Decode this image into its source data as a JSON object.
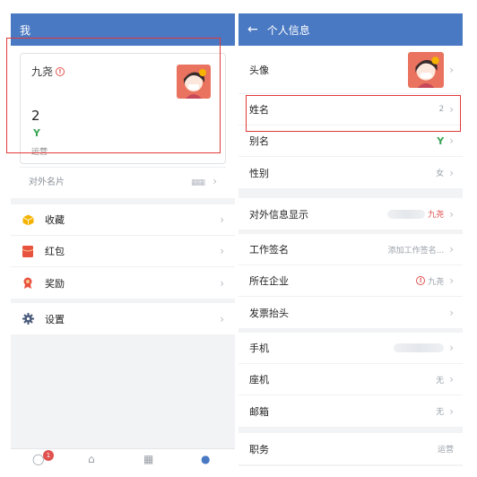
{
  "left": {
    "title": "我",
    "profile": {
      "name": "九尧",
      "number": "2",
      "dept": "运营"
    },
    "namecard_label": "对外名片",
    "menu": [
      {
        "label": "收藏",
        "icon": "box-icon",
        "color": "#f5b300"
      },
      {
        "label": "红包",
        "icon": "red-envelope-icon",
        "color": "#e8533f"
      },
      {
        "label": "奖励",
        "icon": "award-icon",
        "color": "#e8533f"
      }
    ],
    "settings": {
      "label": "设置",
      "icon": "gear-icon"
    },
    "tabbar": {
      "badge": "1"
    }
  },
  "right": {
    "title": "个人信息",
    "rows_group1": [
      {
        "label": "头像",
        "value": ""
      },
      {
        "label": "姓名",
        "value": "2"
      },
      {
        "label": "别名",
        "value": ""
      },
      {
        "label": "性别",
        "value": "女"
      }
    ],
    "ext_info": {
      "label": "对外信息显示",
      "value": "九尧"
    },
    "rows_group2": [
      {
        "label": "工作签名",
        "value": "添加工作签名..."
      },
      {
        "label": "所在企业",
        "value": "九尧"
      },
      {
        "label": "发票抬头",
        "value": ""
      }
    ],
    "rows_group3": [
      {
        "label": "手机",
        "value": ""
      },
      {
        "label": "座机",
        "value": "无"
      },
      {
        "label": "邮箱",
        "value": "无"
      }
    ],
    "job": {
      "label": "职务",
      "value": "运营"
    }
  },
  "colors": {
    "topbar": "#4a79c3",
    "highlight": "#e23a3a",
    "sprout": "#3aa655"
  }
}
